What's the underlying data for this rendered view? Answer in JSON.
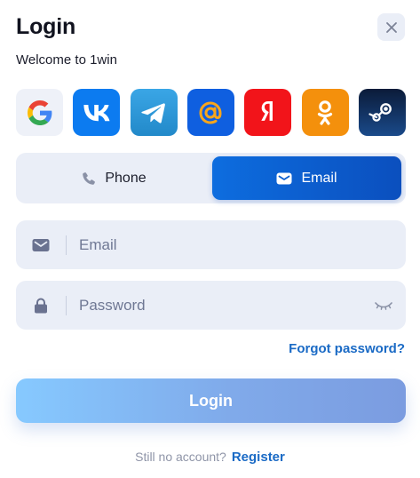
{
  "header": {
    "title": "Login",
    "subtitle": "Welcome to 1win"
  },
  "socials": [
    {
      "name": "google-icon"
    },
    {
      "name": "vk-icon"
    },
    {
      "name": "telegram-icon"
    },
    {
      "name": "mailru-icon"
    },
    {
      "name": "yandex-icon"
    },
    {
      "name": "odnoklassniki-icon"
    },
    {
      "name": "steam-icon"
    }
  ],
  "tabs": {
    "phone_label": "Phone",
    "email_label": "Email",
    "active": "Email"
  },
  "form": {
    "email_placeholder": "Email",
    "email_value": "",
    "password_placeholder": "Password",
    "password_value": ""
  },
  "links": {
    "forgot_password": "Forgot password?"
  },
  "login_button_label": "Login",
  "footer": {
    "prompt": "Still no account?",
    "register_label": "Register"
  },
  "colors": {
    "accent": "#0d6ddf",
    "link": "#1a6ac5",
    "field_bg": "#eaeef7"
  }
}
